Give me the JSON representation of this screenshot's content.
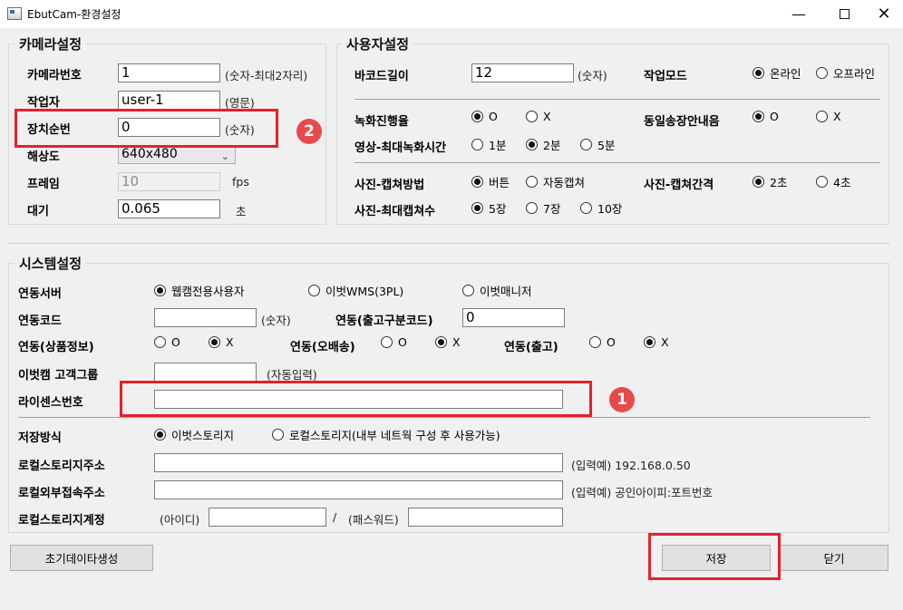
{
  "window": {
    "title": "EbutCam-환경설정"
  },
  "camera": {
    "title": "카메라설정",
    "number_label": "카메라번호",
    "number_value": "1",
    "number_hint": "(숫자-최대2자리)",
    "worker_label": "작업자",
    "worker_value": "user-1",
    "worker_hint": "(영문)",
    "device_label": "장치순번",
    "device_value": "0",
    "device_hint": "(숫자)",
    "resolution_label": "해상도",
    "resolution_value": "640x480",
    "frame_label": "프레임",
    "frame_value": "10",
    "frame_unit": "fps",
    "wait_label": "대기",
    "wait_value": "0.065",
    "wait_unit": "초"
  },
  "user": {
    "title": "사용자설정",
    "barcode_label": "바코드길이",
    "barcode_value": "12",
    "barcode_hint": "(숫자)",
    "mode_label": "작업모드",
    "mode_online": "온라인",
    "mode_offline": "오프라인",
    "record_label": "녹화진행율",
    "record_o": "O",
    "record_x": "X",
    "same_label": "동일송장안내음",
    "same_o": "O",
    "same_x": "X",
    "video_label": "영상-최대녹화시간",
    "video_1": "1분",
    "video_2": "2분",
    "video_5": "5분",
    "capture_method_label": "사진-캡쳐방법",
    "capture_button": "버튼",
    "capture_auto": "자동캡쳐",
    "capture_interval_label": "사진-캡쳐간격",
    "interval_2": "2초",
    "interval_4": "4초",
    "capture_max_label": "사진-최대캡쳐수",
    "max_5": "5장",
    "max_7": "7장",
    "max_10": "10장"
  },
  "system": {
    "title": "시스템설정",
    "link_server_label": "연동서버",
    "server_webcam": "웹캠전용사용자",
    "server_wms": "이벗WMS(3PL)",
    "server_manager": "이벗매니저",
    "link_code_label": "연동코드",
    "link_code_value": "",
    "link_code_hint": "(숫자)",
    "link_out_label": "연동(출고구분코드)",
    "link_out_value": "0",
    "link_product_label": "연동(상품정보)",
    "link_delivery_label": "연동(오배송)",
    "link_release_label": "연동(출고)",
    "opt_o": "O",
    "opt_x": "X",
    "customer_group_label": "이벗캠 고객그룹",
    "customer_group_value": "",
    "customer_group_hint": "(자동입력)",
    "license_label": "라이센스번호",
    "license_value": "",
    "storage_label": "저장방식",
    "storage_ebut": "이벗스토리지",
    "storage_local": "로컬스토리지(내부 네트웍 구성 후 사용가능)",
    "local_addr_label": "로컬스토리지주소",
    "local_addr_value": "",
    "local_addr_hint": "(입력예) 192.168.0.50",
    "external_addr_label": "로컬외부접속주소",
    "external_addr_value": "",
    "external_addr_hint": "(입력예) 공인아이피:포트번호",
    "account_label": "로컬스토리지계정",
    "id_label": "(아이디)",
    "slash": "/",
    "pw_label": "(패스워드)"
  },
  "buttons": {
    "init": "초기데이타생성",
    "save": "저장",
    "close": "닫기"
  },
  "badges": {
    "one": "1",
    "two": "2"
  },
  "colors": {
    "highlight": "#e8202a",
    "badge": "#e84a4a"
  }
}
